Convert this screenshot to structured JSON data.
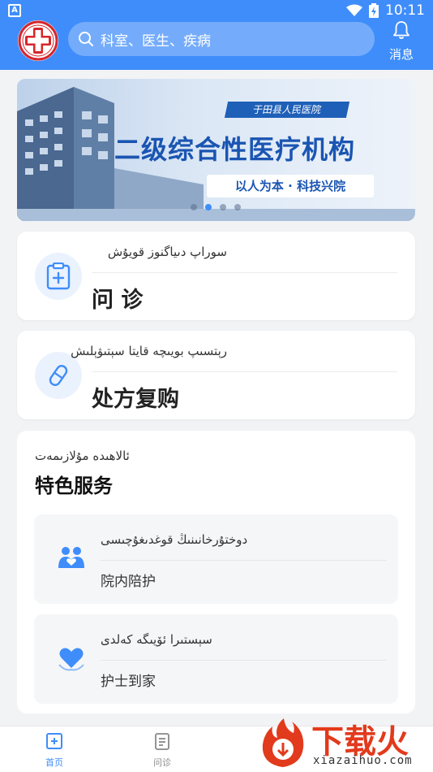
{
  "status_bar": {
    "left_glyph": "A",
    "time": "10:11"
  },
  "header": {
    "search_placeholder": "科室、医生、疾病",
    "message_label": "消息"
  },
  "banner": {
    "hospital_name": "于田县人民医院",
    "title": "二级综合性医疗机构",
    "subtitle": "以人为本 · 科技兴院",
    "page_count": 4,
    "active_page": 2
  },
  "cards": [
    {
      "uyghur": "سوراپ دىياگنوز قويۇش",
      "title": "问 诊",
      "icon": "clipboard-plus-icon"
    },
    {
      "uyghur": "رېتسىپ بويىچە قايتا سېتىۋېلىش",
      "title": "处方复购",
      "icon": "pill-icon"
    }
  ],
  "special_services": {
    "uyghur": "ئالاھىدە مۇلازىمەت",
    "title": "特色服务",
    "items": [
      {
        "uyghur": "دوختۇرخانىنىڭ قوغدىغۇچىسى",
        "title": "院内陪护",
        "icon": "caregiver-icon"
      },
      {
        "uyghur": "سېستىرا ئۆيىگە كەلدى",
        "title": "护士到家",
        "icon": "nurse-heart-icon"
      }
    ]
  },
  "bottom_nav": [
    {
      "label": "首页",
      "active": true,
      "icon": "home-plus-icon"
    },
    {
      "label": "问诊",
      "active": false,
      "icon": "document-icon"
    }
  ],
  "watermark": {
    "text": "下载火",
    "url": "xiazaihuo.com"
  },
  "colors": {
    "primary": "#3f8dfa",
    "background": "#f2f3f5",
    "card": "#ffffff",
    "brand_red": "#e23a1c"
  }
}
